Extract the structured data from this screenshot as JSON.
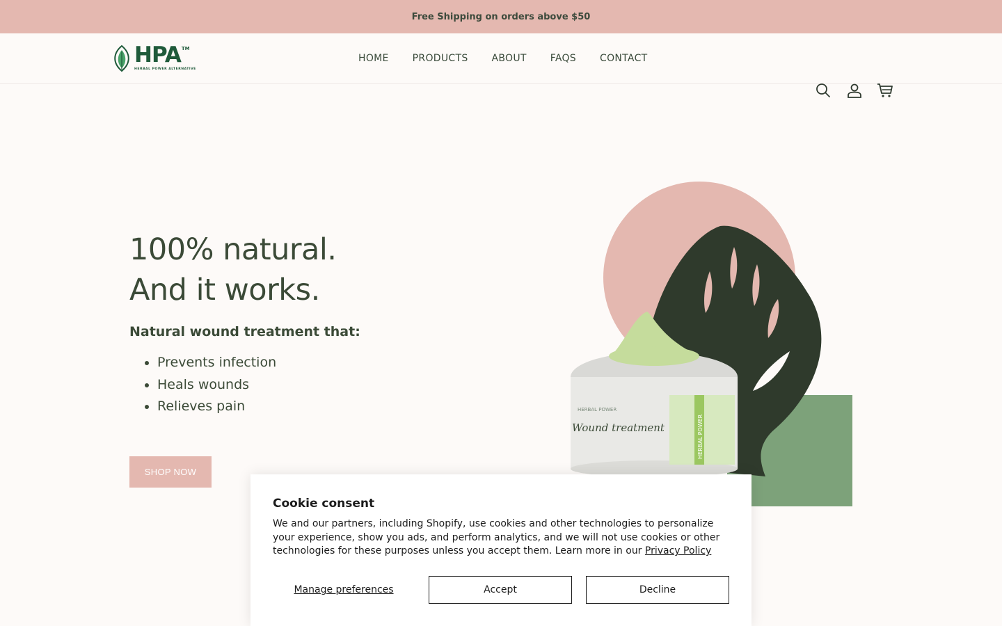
{
  "announcement": {
    "text": "Free Shipping on orders above $50"
  },
  "logo": {
    "letters": "HPA",
    "tm": "TM",
    "subtitle": "HERBAL POWER ALTERNATIVE"
  },
  "nav": {
    "items": [
      "HOME",
      "PRODUCTS",
      "ABOUT",
      "FAQS",
      "CONTACT"
    ]
  },
  "header_icons": [
    "search-icon",
    "account-icon",
    "cart-icon"
  ],
  "hero": {
    "title_line1": "100% natural.",
    "title_line2": "And it works.",
    "subtitle": "Natural wound treatment that:",
    "bullets": [
      "Prevents infection",
      "Heals wounds",
      "Relieves pain"
    ],
    "cta": "SHOP NOW",
    "product_jar": {
      "brand": "HERBAL POWER",
      "name": "Wound treatment",
      "side_text": "HERBAL POWER"
    }
  },
  "cookie": {
    "title": "Cookie consent",
    "body": "We and our partners, including Shopify, use cookies and other technologies to personalize your experience, show you ads, and perform analytics, and we will not use cookies or other technologies for these purposes unless you accept them. Learn more in our ",
    "policy_link": "Privacy Policy",
    "manage": "Manage preferences",
    "accept": "Accept",
    "decline": "Decline"
  },
  "colors": {
    "accent_pink": "#e4b8b0",
    "brand_green": "#1f5a3a",
    "leaf_dark": "#2f3a2c",
    "square_green": "#7da27a",
    "cream_green": "#c5dc9c",
    "text": "#3b4a37"
  }
}
